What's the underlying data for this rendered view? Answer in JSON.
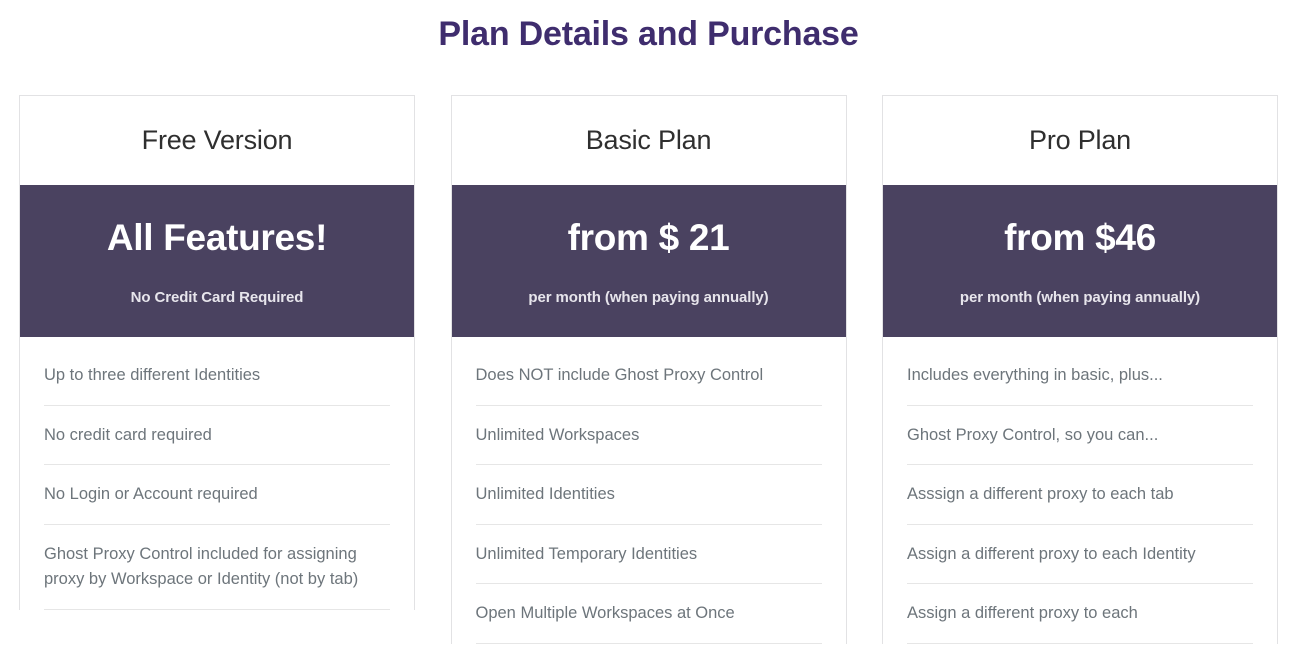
{
  "page": {
    "title": "Plan Details and Purchase",
    "title_color": "#3f2d6e",
    "band_color": "#4a4260",
    "feature_text_color": "#6d757b",
    "card_border_color": "#e2e2e4"
  },
  "plans": [
    {
      "name": "Free Version",
      "price": "All Features!",
      "price_note": "No Credit Card Required",
      "features": [
        "Up to three different Identities",
        "No credit card required",
        "No Login or Account required",
        "Ghost Proxy Control included for assigning proxy by Workspace or Identity (not by tab)"
      ]
    },
    {
      "name": "Basic Plan",
      "price": "from $ 21",
      "price_note": "per month (when paying annually)",
      "features": [
        "Does NOT include Ghost Proxy Control",
        "Unlimited Workspaces",
        "Unlimited Identities",
        "Unlimited Temporary Identities",
        "Open Multiple Workspaces at Once"
      ]
    },
    {
      "name": "Pro Plan",
      "price": "from $46",
      "price_note": "per month (when paying annually)",
      "features": [
        "Includes everything in basic, plus...",
        "Ghost Proxy Control, so you can...",
        "Asssign a different proxy to each tab",
        "Assign a different proxy to each Identity",
        "Assign a different proxy to each"
      ]
    }
  ]
}
